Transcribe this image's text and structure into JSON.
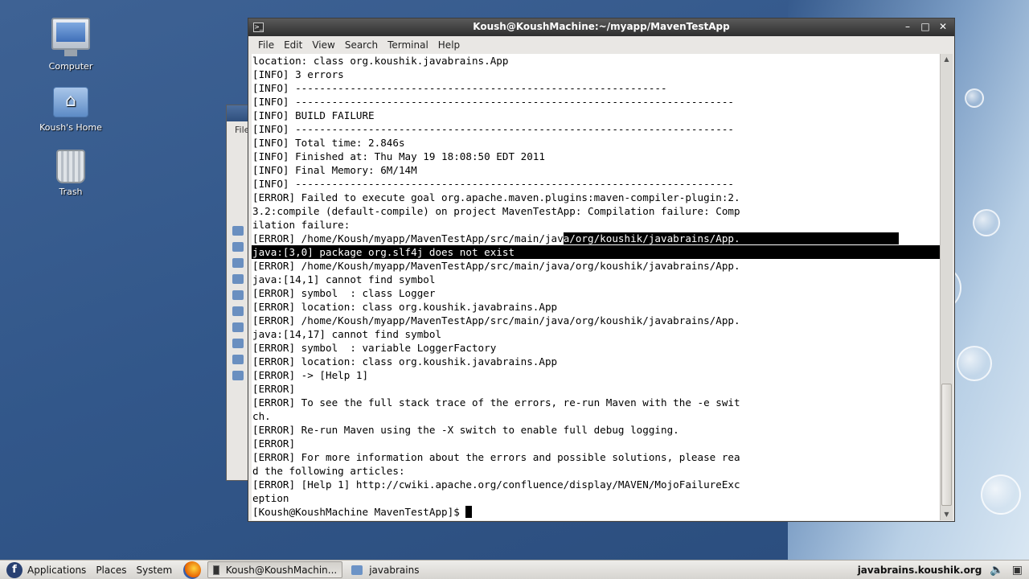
{
  "desktop": {
    "icons": [
      {
        "label": "Computer"
      },
      {
        "label": "Koush's Home"
      },
      {
        "label": "Trash"
      }
    ]
  },
  "background_window": {
    "menu_fragment": "File"
  },
  "terminal": {
    "title": "Koush@KoushMachine:~/myapp/MavenTestApp",
    "menu": [
      "File",
      "Edit",
      "View",
      "Search",
      "Terminal",
      "Help"
    ],
    "lines": [
      "location: class org.koushik.javabrains.App",
      "[INFO] 3 errors",
      "[INFO] -------------------------------------------------------------",
      "[INFO] ------------------------------------------------------------------------",
      "[INFO] BUILD FAILURE",
      "[INFO] ------------------------------------------------------------------------",
      "[INFO] Total time: 2.846s",
      "[INFO] Finished at: Thu May 19 18:08:50 EDT 2011",
      "[INFO] Final Memory: 6M/14M",
      "[INFO] ------------------------------------------------------------------------",
      "[ERROR] Failed to execute goal org.apache.maven.plugins:maven-compiler-plugin:2.",
      "3.2:compile (default-compile) on project MavenTestApp: Compilation failure: Comp",
      "ilation failure:",
      "[ERROR] /home/Koush/myapp/MavenTestApp/src/main/java/org/koushik/javabrains/App.",
      "java:[3,0] package org.slf4j does not exist",
      "[ERROR] /home/Koush/myapp/MavenTestApp/src/main/java/org/koushik/javabrains/App.",
      "java:[14,1] cannot find symbol",
      "[ERROR] symbol  : class Logger",
      "[ERROR] location: class org.koushik.javabrains.App",
      "[ERROR] /home/Koush/myapp/MavenTestApp/src/main/java/org/koushik/javabrains/App.",
      "java:[14,17] cannot find symbol",
      "[ERROR] symbol  : variable LoggerFactory",
      "[ERROR] location: class org.koushik.javabrains.App",
      "[ERROR] -> [Help 1]",
      "[ERROR]",
      "[ERROR] To see the full stack trace of the errors, re-run Maven with the -e swit",
      "ch.",
      "[ERROR] Re-run Maven using the -X switch to enable full debug logging.",
      "[ERROR]",
      "[ERROR] For more information about the errors and possible solutions, please rea",
      "d the following articles:",
      "[ERROR] [Help 1] http://cwiki.apache.org/confluence/display/MAVEN/MojoFailureExc",
      "eption"
    ],
    "selection": {
      "line13_unselected": "[ERROR] /home/Koush/myapp/MavenTestApp/src/main/jav",
      "line13_selected": "a/org/koushik/javabrains/App.                          "
    },
    "prompt": "[Koush@KoushMachine MavenTestApp]$ "
  },
  "taskbar": {
    "applications": "Applications",
    "places": "Places",
    "system": "System",
    "tasks": [
      {
        "label": "Koush@KoushMachin..."
      },
      {
        "label": "javabrains"
      }
    ],
    "site": "javabrains.koushik.org"
  },
  "colors": {
    "desktop_bg": "#3e6294",
    "terminal_bg": "#ffffff",
    "selection_bg": "#000000"
  }
}
